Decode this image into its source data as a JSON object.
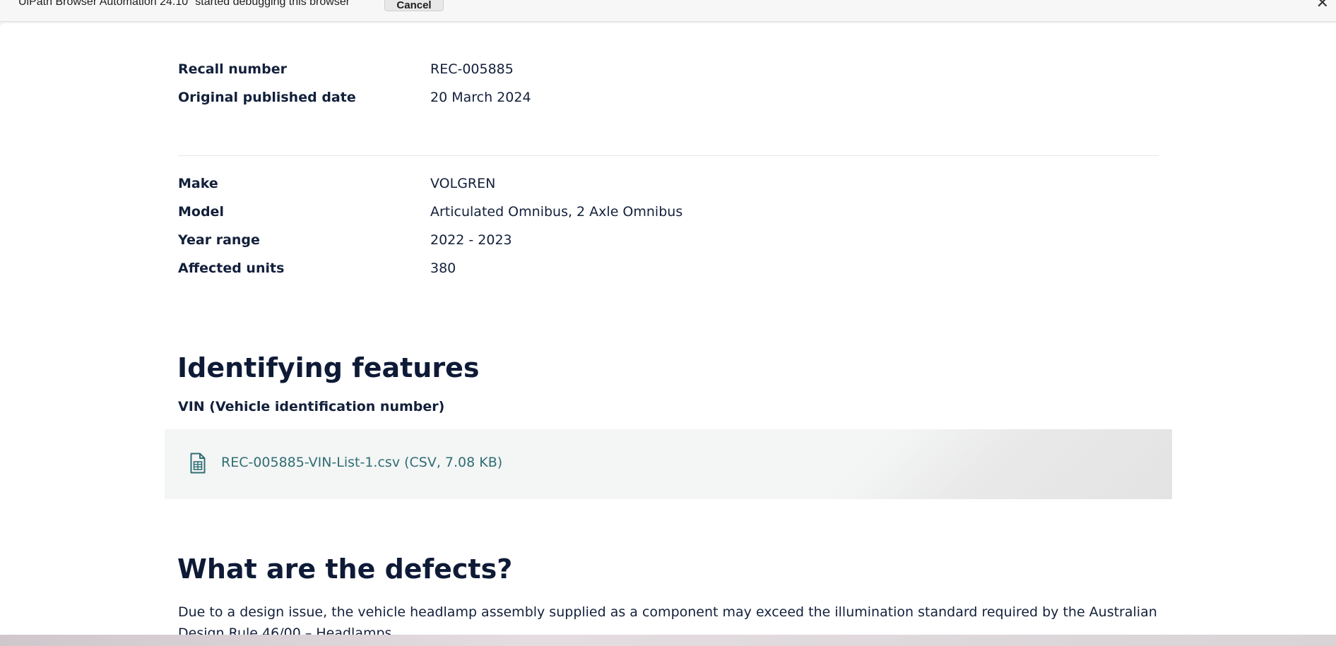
{
  "infobar": {
    "message": "UiPath Browser Automation 24.10\" started debugging this browser",
    "cancel_label": "Cancel",
    "close_glyph": "✕"
  },
  "recall": {
    "number_label": "Recall number",
    "number_value": "REC-005885",
    "date_label": "Original published date",
    "date_value": "20 March 2024"
  },
  "vehicle": {
    "make_label": "Make",
    "make_value": "VOLGREN",
    "model_label": "Model",
    "model_value": "Articulated Omnibus, 2 Axle Omnibus",
    "year_label": "Year range",
    "year_value": "2022 - 2023",
    "units_label": "Affected units",
    "units_value": "380"
  },
  "identifying": {
    "heading": "Identifying features",
    "subheading": "VIN (Vehicle identification number)",
    "file_icon": "csv-file-icon",
    "file_link": "REC-005885-VIN-List-1.csv (CSV, 7.08 KB)"
  },
  "defects": {
    "heading": "What are the defects?",
    "text": "Due to a design issue, the vehicle headlamp assembly supplied as a component may exceed the illumination standard required by the Australian Design Rule 46/00 – Headlamps."
  },
  "colors": {
    "heading": "#0e1a36",
    "text": "#13203b",
    "link": "#2f6e74",
    "file_box_bg": "#f4f5f5"
  }
}
